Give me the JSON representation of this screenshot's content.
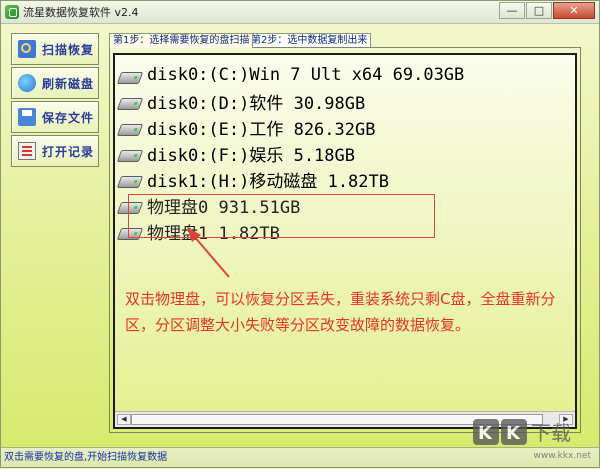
{
  "window": {
    "title": "流星数据恢复软件 v2.4",
    "blurred_title": "",
    "min_label": "—",
    "max_label": "□",
    "close_label": "✕"
  },
  "sidebar": {
    "items": [
      {
        "label": "扫描恢复",
        "icon": "scan-icon"
      },
      {
        "label": "刷新磁盘",
        "icon": "refresh-icon"
      },
      {
        "label": "保存文件",
        "icon": "save-icon"
      },
      {
        "label": "打开记录",
        "icon": "log-icon"
      }
    ]
  },
  "tabs": [
    {
      "label": "第1步：选择需要恢复的盘扫描",
      "active": true
    },
    {
      "label": "第2步：选中数据复制出来",
      "active": false
    }
  ],
  "drives": [
    {
      "label": "disk0:(C:)Win 7 Ult x64 69.03GB"
    },
    {
      "label": "disk0:(D:)软件 30.98GB"
    },
    {
      "label": "disk0:(E:)工作 826.32GB"
    },
    {
      "label": "disk0:(F:)娱乐 5.18GB"
    },
    {
      "label": "disk1:(H:)移动磁盘 1.82TB"
    },
    {
      "label": "物理盘0 931.51GB"
    },
    {
      "label": "物理盘1 1.82TB"
    }
  ],
  "annotation": {
    "text": "双击物理盘，可以恢复分区丢失，重装系统只剩C盘，全盘重新分区，分区调整大小失败等分区改变故障的数据恢复。",
    "color": "#e8322b"
  },
  "statusbar": {
    "text": "双击需要恢复的盘,开始扫描恢复数据"
  },
  "watermark": {
    "logo": "KK下载",
    "url": "www.kkx.net"
  },
  "colors": {
    "accent": "#2a3c9c",
    "annotation": "#e8322b",
    "background": "#dbec70"
  }
}
